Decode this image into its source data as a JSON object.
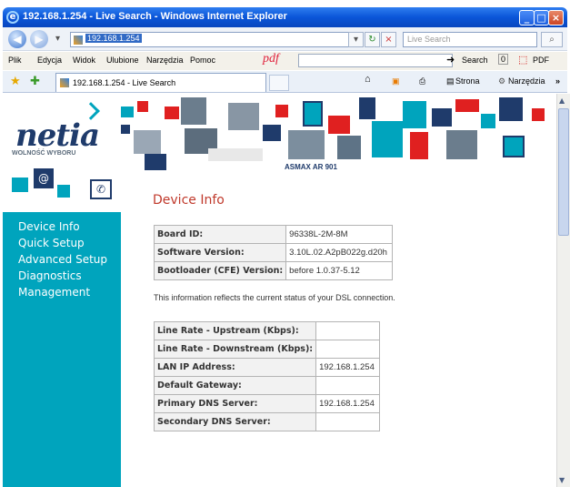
{
  "window": {
    "title": "192.168.1.254 - Live Search - Windows Internet Explorer"
  },
  "address": {
    "url": "192.168.1.254",
    "search_placeholder": "Live Search"
  },
  "menubar": {
    "items": [
      "Plik",
      "Edycja",
      "Widok",
      "Ulubione",
      "Narzędzia",
      "Pomoc"
    ],
    "pdf_label": "pdf",
    "search_label": "Search",
    "count": "0",
    "pdf_button": "PDF"
  },
  "tabbar": {
    "tab_title": "192.168.1.254 - Live Search",
    "strona": "Strona",
    "narzedzia": "Narzędzia"
  },
  "brand": {
    "logo": "netia",
    "tagline": "WOLNOŚĆ WYBORU",
    "model": "ASMAX AR 901"
  },
  "sidebar": {
    "items": [
      "Device Info",
      "Quick Setup",
      "Advanced Setup",
      "Diagnostics",
      "Management"
    ]
  },
  "main": {
    "title": "Device Info",
    "device_rows": [
      {
        "label": "Board ID:",
        "value": "96338L-2M-8M"
      },
      {
        "label": "Software Version:",
        "value": "3.10L.02.A2pB022g.d20h"
      },
      {
        "label": "Bootloader (CFE) Version:",
        "value": "before 1.0.37-5.12"
      }
    ],
    "note": "This information reflects the current status of your DSL connection.",
    "status_rows": [
      {
        "label": "Line Rate - Upstream (Kbps):",
        "value": ""
      },
      {
        "label": "Line Rate - Downstream (Kbps):",
        "value": ""
      },
      {
        "label": "LAN IP Address:",
        "value": "192.168.1.254"
      },
      {
        "label": "Default Gateway:",
        "value": ""
      },
      {
        "label": "Primary DNS Server:",
        "value": "192.168.1.254"
      },
      {
        "label": "Secondary DNS Server:",
        "value": ""
      }
    ]
  },
  "colors": {
    "sidebar": "#00a4bd",
    "title": "#c0392b",
    "xp_blue": "#0a55d8"
  }
}
